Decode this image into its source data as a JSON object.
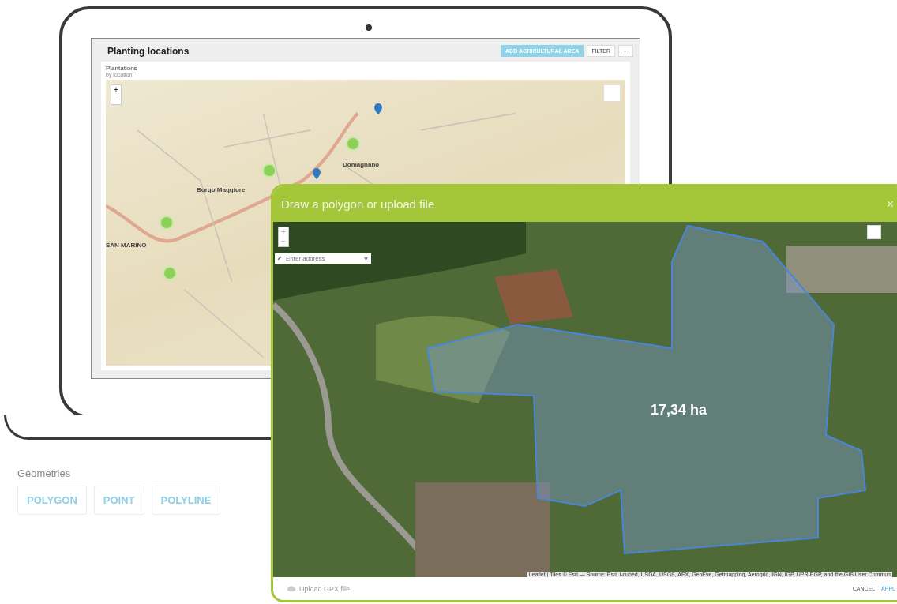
{
  "laptop_screen": {
    "title": "Planting locations",
    "add_button": "ADD AGRICULTURAL AREA",
    "filter_button": "FILTER",
    "more_button": "···",
    "panel": {
      "title": "Plantations",
      "subtitle": "by location"
    },
    "map": {
      "zoom_in": "+",
      "zoom_out": "−",
      "place_labels": [
        "Domagnano",
        "Borgo Maggiore",
        "SAN MARINO"
      ]
    }
  },
  "dialog": {
    "title": "Draw a polygon or upload file",
    "close": "×",
    "zoom_in": "+",
    "zoom_out": "−",
    "address_placeholder": "Enter address",
    "area_label": "17,34 ha",
    "attribution": "Leaflet | Tiles © Esri — Source: Esri, i-cubed, USDA, USGS, AEX, GeoEye, Getmapping, Aerogrid, IGN, IGP, UPR-EGP, and the GIS User Commun",
    "upload_label": "Upload GPX file",
    "cancel": "CANCEL",
    "apply": "APPL"
  },
  "geometries": {
    "label": "Geometries",
    "options": [
      "POLYGON",
      "POINT",
      "POLYLINE"
    ]
  }
}
